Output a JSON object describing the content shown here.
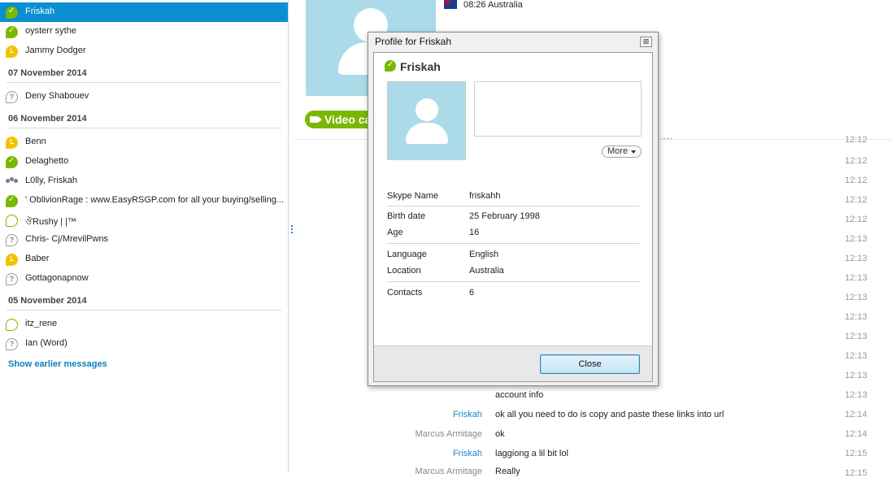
{
  "contacts_top": [
    {
      "name": "Friskah",
      "status": "online",
      "selected": true
    },
    {
      "name": "oysterr sythe",
      "status": "online"
    },
    {
      "name": "Jammy Dodger",
      "status": "away"
    }
  ],
  "groups": [
    {
      "date": "07 November 2014",
      "items": [
        {
          "name": "Deny Shabouev",
          "status": "unknown"
        }
      ]
    },
    {
      "date": "06 November 2014",
      "items": [
        {
          "name": "Benn",
          "status": "away"
        },
        {
          "name": "Delaghetto",
          "status": "online"
        },
        {
          "name": "L0lly, Friskah",
          "status": "group"
        },
        {
          "name": "' OblivionRage : www.EasyRSGP.com for all your buying/selling...",
          "status": "online"
        },
        {
          "name": "ঔRushy | |™",
          "status": "offline"
        },
        {
          "name": "Chris- Cj/MrevilPwns",
          "status": "unknown"
        },
        {
          "name": "Baber",
          "status": "away"
        },
        {
          "name": "Gottagonapnow",
          "status": "unknown"
        }
      ]
    },
    {
      "date": "05 November 2014",
      "items": [
        {
          "name": "itz_rene",
          "status": "offline"
        },
        {
          "name": "Ian (Word)",
          "status": "unknown"
        }
      ]
    }
  ],
  "show_earlier": "Show earlier messages",
  "chat_header": {
    "location": "08:26 Australia",
    "video_button": "Video ca",
    "more_dots": "..."
  },
  "timestamps": [
    "12:12",
    "12:12",
    "12:12",
    "12:12",
    "12:12",
    "12:13",
    "12:13",
    "12:13",
    "12:13",
    "12:13",
    "12:13",
    "12:13",
    "12:13",
    "12:13",
    "12:14",
    "12:14",
    "12:15",
    "12:15"
  ],
  "messages": [
    {
      "sender": "",
      "text": "account info"
    },
    {
      "sender": "Friskah",
      "text": "ok all you need to do is copy and paste these links into url"
    },
    {
      "sender": "Marcus Armitage",
      "text": "ok"
    },
    {
      "sender": "Friskah",
      "text": "laggiong a lil bit lol"
    },
    {
      "sender": "Marcus Armitage",
      "text": "Really"
    }
  ],
  "dialog": {
    "title": "Profile for Friskah",
    "close_x": "⊠",
    "name": "Friskah",
    "more_label": "More",
    "fields": [
      {
        "label": "Skype Name",
        "value": "friskahh"
      },
      {
        "label": "Birth date",
        "value": "25 February 1998"
      },
      {
        "label": "Age",
        "value": "16"
      },
      {
        "label": "Language",
        "value": "English"
      },
      {
        "label": "Location",
        "value": "Australia"
      },
      {
        "label": "Contacts",
        "value": "6"
      }
    ],
    "close_button": "Close"
  },
  "colors": {
    "online": "#7ab800",
    "away": "#f2c300",
    "selected": "#0b8fd0",
    "link": "#0b7fc1",
    "avatar_bg": "#abdbe9"
  }
}
